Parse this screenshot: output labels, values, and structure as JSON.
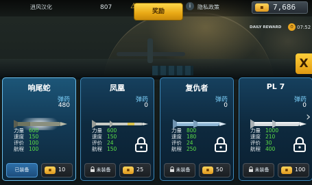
{
  "topbar": {
    "back_label": "逍风汉化",
    "score": "807",
    "reward_label": "奖励",
    "privacy_label": "隐私政策",
    "currency_value": "7,686"
  },
  "daily": {
    "label": "DAILY REWARD",
    "timer": "07:52"
  },
  "close_label": "X",
  "stat_labels": {
    "power": "力量",
    "speed": "速度",
    "rating": "评价",
    "range": "航程"
  },
  "ammo_label": "弹药",
  "cards": [
    {
      "name": "响尾蛇",
      "ammo": "480",
      "power": "600",
      "speed": "150",
      "rating": "100",
      "range": "100",
      "equip_label": "已装备",
      "price": "10",
      "locked": false
    },
    {
      "name": "凤凰",
      "ammo": "0",
      "power": "600",
      "speed": "150",
      "rating": "24",
      "range": "150",
      "equip_label": "未装备",
      "price": "25",
      "locked": true
    },
    {
      "name": "复仇者",
      "ammo": "0",
      "power": "800",
      "speed": "180",
      "rating": "24",
      "range": "250",
      "equip_label": "未装备",
      "price": "50",
      "locked": true
    },
    {
      "name": "PL 7",
      "ammo": "0",
      "power": "1000",
      "speed": "210",
      "rating": "30",
      "range": "400",
      "equip_label": "未装备",
      "price": "100",
      "locked": true
    }
  ]
}
